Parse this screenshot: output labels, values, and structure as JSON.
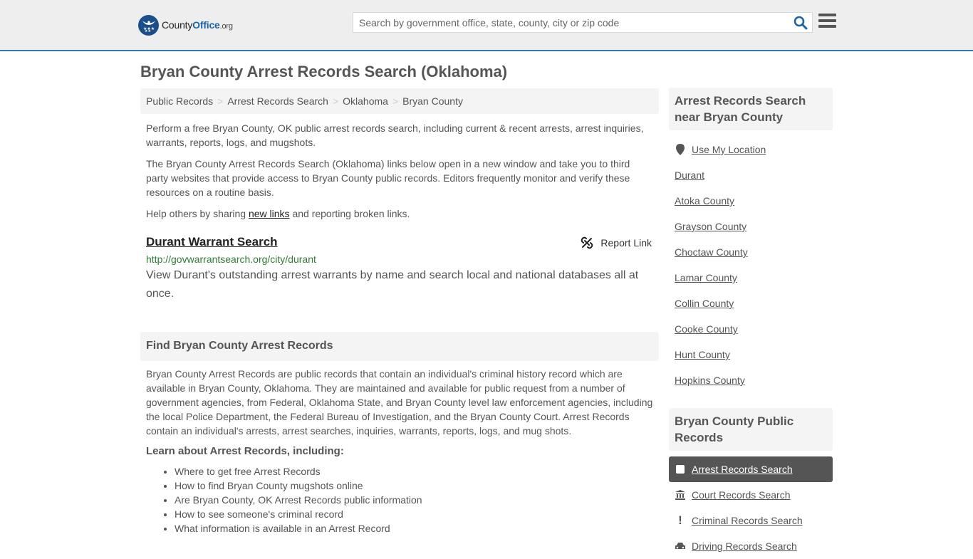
{
  "header": {
    "logo": {
      "name_part1": "County",
      "name_part2": "Office",
      "name_part3": ".org"
    },
    "search": {
      "placeholder": "Search by government office, state, county, city or zip code",
      "value": ""
    },
    "accent_color": "#337ab7"
  },
  "page_title": "Bryan County Arrest Records Search (Oklahoma)",
  "breadcrumb": [
    "Public Records",
    "Arrest Records Search",
    "Oklahoma",
    "Bryan County"
  ],
  "intro": {
    "p1": "Perform a free Bryan County, OK public arrest records search, including current & recent arrests, arrest inquiries, warrants, reports, logs, and mugshots.",
    "p2": "The Bryan County Arrest Records Search (Oklahoma) links below open in a new window and take you to third party websites that provide access to Bryan County public records. Editors frequently monitor and verify these resources on a routine basis.",
    "p3_before": "Help others by sharing ",
    "p3_link": "new links",
    "p3_after": " and reporting broken links."
  },
  "links": [
    {
      "title": "Durant Warrant Search",
      "url": "http://govwarrantsearch.org/city/durant",
      "description": "View Durant's outstanding arrest warrants by name and search local and national databases all at once.",
      "report_label": "Report Link"
    }
  ],
  "find_section": {
    "heading": "Find Bryan County Arrest Records",
    "body": "Bryan County Arrest Records are public records that contain an individual's criminal history record which are available in Bryan County, Oklahoma. They are maintained and available for public request from a number of government agencies, from Federal, Oklahoma State, and Bryan County level law enforcement agencies, including the local Police Department, the Federal Bureau of Investigation, and the Bryan County Court. Arrest Records contain an individual's arrests, arrest searches, inquiries, warrants, reports, logs, and mug shots.",
    "learn_heading": "Learn about Arrest Records, including:",
    "learn_items": [
      "Where to get free Arrest Records",
      "How to find Bryan County mugshots online",
      "Are Bryan County, OK Arrest Records public information",
      "How to see someone's criminal record",
      "What information is available in an Arrest Record"
    ]
  },
  "sidebar": {
    "nearby_heading": "Arrest Records Search near Bryan County",
    "use_location": "Use My Location",
    "nearby": [
      "Durant",
      "Atoka County",
      "Grayson County",
      "Choctaw County",
      "Lamar County",
      "Collin County",
      "Cooke County",
      "Hunt County",
      "Hopkins County"
    ],
    "public_heading": "Bryan County Public Records",
    "public_records": [
      {
        "label": "Arrest Records Search",
        "icon": "square-icon",
        "active": true
      },
      {
        "label": "Court Records Search",
        "icon": "courthouse-icon",
        "active": false
      },
      {
        "label": "Criminal Records Search",
        "icon": "exclamation-icon",
        "active": false
      },
      {
        "label": "Driving Records Search",
        "icon": "car-icon",
        "active": false
      }
    ]
  }
}
